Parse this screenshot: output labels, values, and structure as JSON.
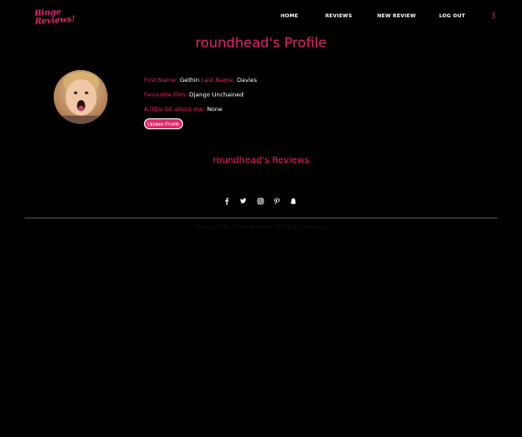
{
  "logo": {
    "line1": "Binge",
    "line2": "Reviews!"
  },
  "nav": {
    "items": [
      "HOME",
      "REVIEWS",
      "NEW REVIEW",
      "LOG OUT"
    ],
    "count": "3"
  },
  "profile": {
    "title": "roundhead's Profile",
    "first_name_label": "First Name:",
    "first_name": "Gethin",
    "last_name_label": "Last Name:",
    "last_name": "Davies",
    "fav_film_label": "Favourite Film:",
    "fav_film": "Django Unchained",
    "about_label": "A little bit about me:",
    "about": "None",
    "update_button": "Update Profile"
  },
  "reviews": {
    "title": "roundhead's Reviews"
  },
  "social": {
    "icons": [
      "facebook-icon",
      "twitter-icon",
      "instagram-icon",
      "pinterest-icon",
      "snapchat-icon"
    ]
  },
  "footer": {
    "copyright": "Copyright by Binge Reviews. All rights reserved."
  },
  "colors": {
    "accent": "#e8246d",
    "background": "#000000",
    "text": "#ffffff",
    "divider": "#555555"
  }
}
